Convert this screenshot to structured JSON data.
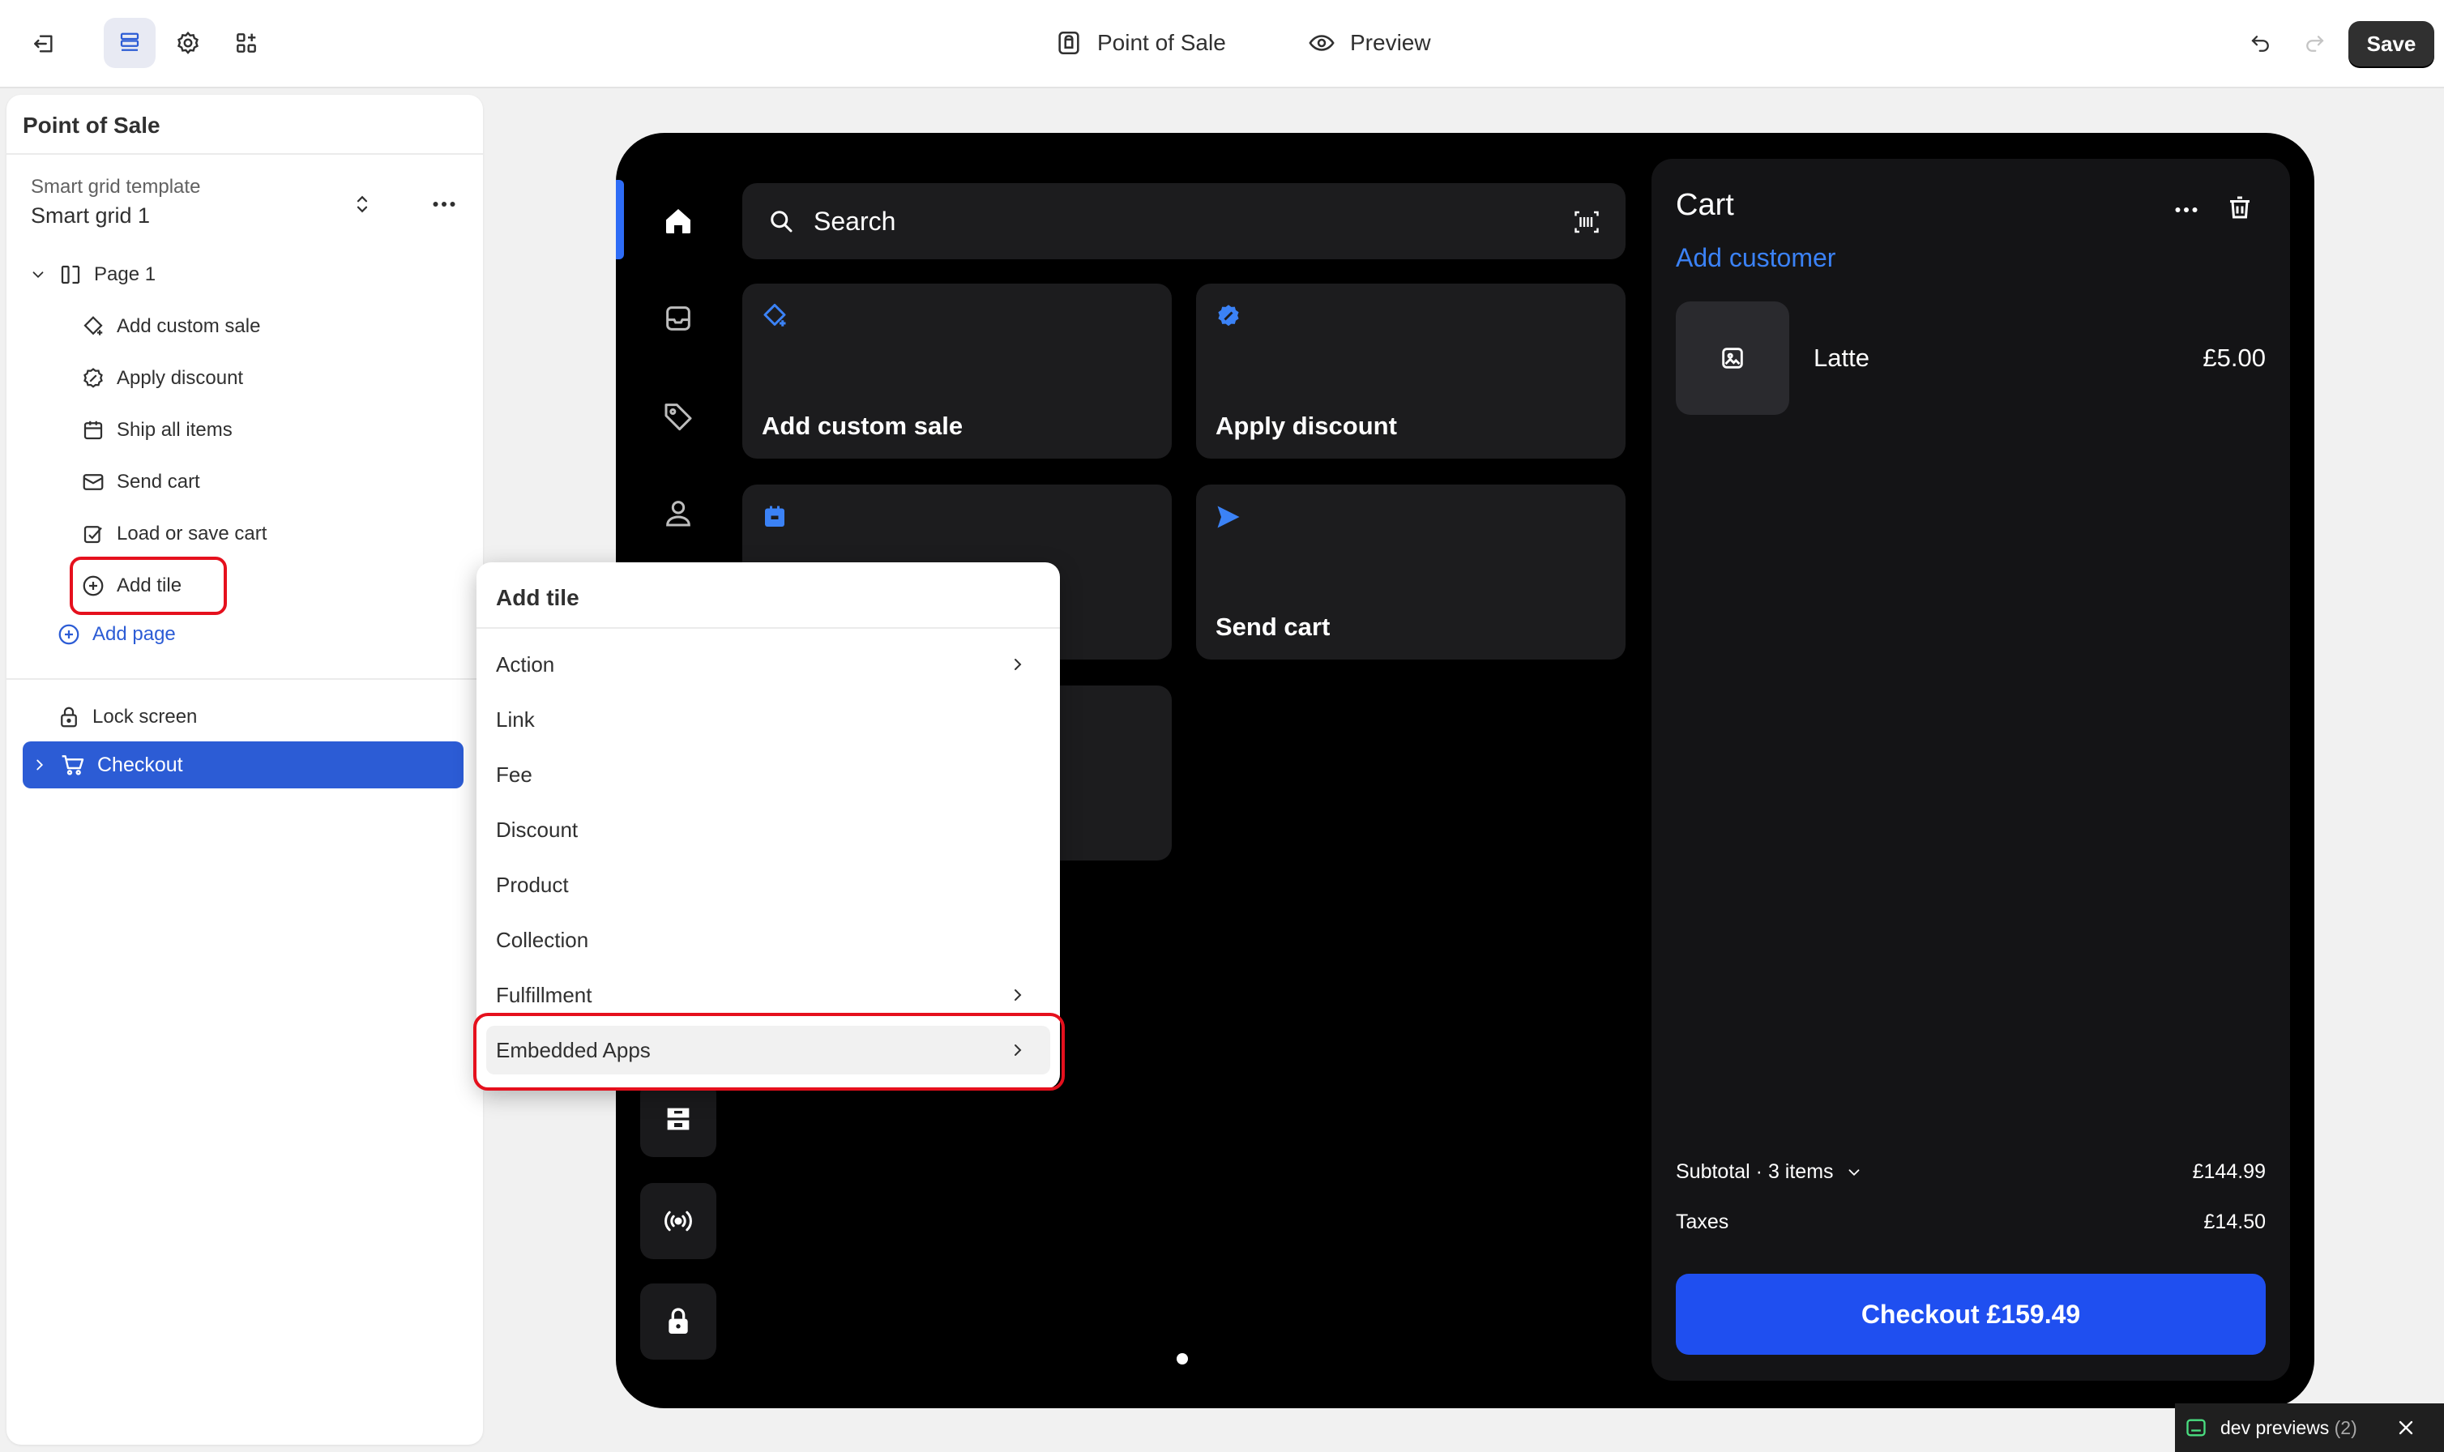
{
  "topbar": {
    "center_items": [
      {
        "label": "Point of Sale",
        "icon": "pos-bag-icon"
      },
      {
        "label": "Preview",
        "icon": "eye-icon"
      }
    ],
    "save_label": "Save"
  },
  "panel": {
    "title": "Point of Sale",
    "template_label": "Smart grid template",
    "template_value": "Smart grid 1",
    "page_label": "Page 1",
    "tiles": [
      {
        "label": "Add custom sale",
        "icon": "custom-sale-icon"
      },
      {
        "label": "Apply discount",
        "icon": "discount-icon"
      },
      {
        "label": "Ship all items",
        "icon": "ship-icon"
      },
      {
        "label": "Send cart",
        "icon": "mail-icon"
      },
      {
        "label": "Load or save cart",
        "icon": "save-cart-icon"
      }
    ],
    "add_tile_label": "Add tile",
    "add_page_label": "Add page",
    "lock_screen_label": "Lock screen",
    "checkout_label": "Checkout"
  },
  "pos": {
    "search_placeholder": "Search",
    "tiles": [
      {
        "label": "Add custom sale",
        "icon": "custom-sale-icon"
      },
      {
        "label": "Apply discount",
        "icon": "discount-icon"
      },
      {
        "label": "",
        "icon": "ship-icon"
      },
      {
        "label": "Send cart",
        "icon": "send-icon"
      },
      {
        "label": "",
        "icon": ""
      }
    ],
    "cart": {
      "title": "Cart",
      "add_customer": "Add customer",
      "items": [
        {
          "name": "Latte",
          "price": "£5.00"
        }
      ],
      "subtotal_label": "Subtotal · 3 items",
      "subtotal_value": "£144.99",
      "taxes_label": "Taxes",
      "taxes_value": "£14.50",
      "checkout_label": "Checkout £159.49"
    },
    "colors": {
      "accent": "#1f4ff0",
      "link": "#3b82f6"
    }
  },
  "dropdown": {
    "title": "Add tile",
    "items": [
      {
        "label": "Action",
        "has_submenu": true
      },
      {
        "label": "Link",
        "has_submenu": false
      },
      {
        "label": "Fee",
        "has_submenu": false
      },
      {
        "label": "Discount",
        "has_submenu": false
      },
      {
        "label": "Product",
        "has_submenu": false
      },
      {
        "label": "Collection",
        "has_submenu": false
      },
      {
        "label": "Fulfillment",
        "has_submenu": true
      },
      {
        "label": "Embedded Apps",
        "has_submenu": true
      }
    ]
  },
  "dev_previews": {
    "label": "dev previews",
    "count": "(2)"
  },
  "colors": {
    "highlight": "#e5101d",
    "selected": "#2c5cd5"
  }
}
